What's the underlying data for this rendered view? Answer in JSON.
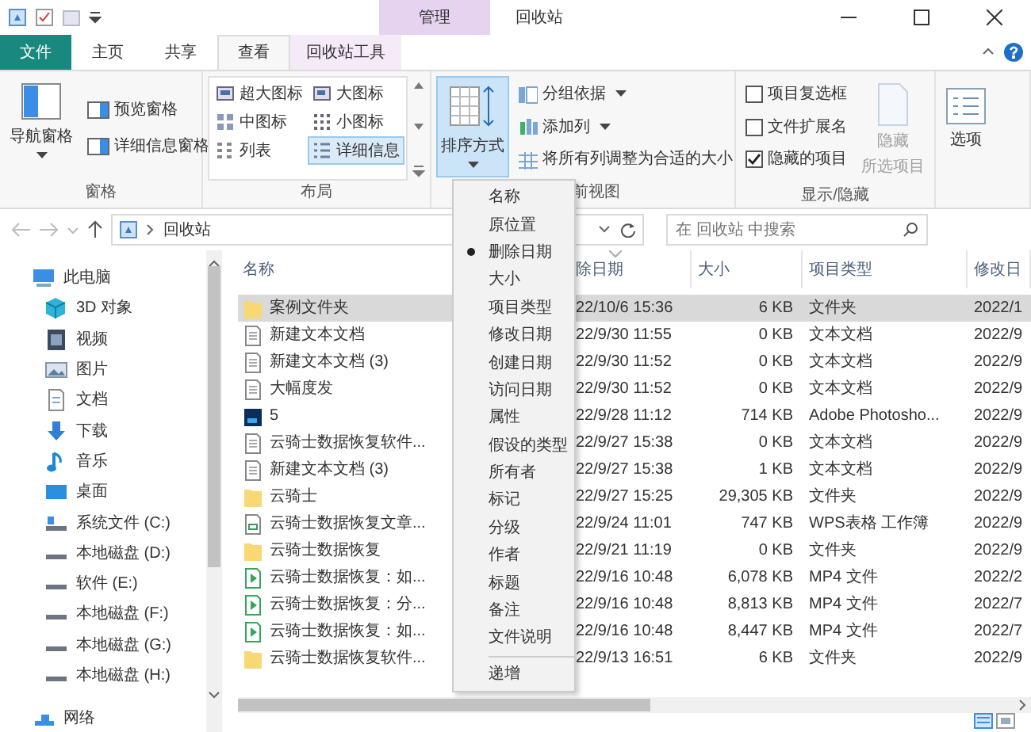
{
  "window": {
    "title": "回收站",
    "context_group": "管理"
  },
  "tabs": [
    {
      "label": "文件",
      "kind": "file",
      "selected": false
    },
    {
      "label": "主页",
      "kind": "plain",
      "selected": false
    },
    {
      "label": "共享",
      "kind": "plain",
      "selected": false
    },
    {
      "label": "查看",
      "kind": "plain",
      "selected": true
    },
    {
      "label": "回收站工具",
      "kind": "context",
      "selected": false
    }
  ],
  "ribbon": {
    "groups": [
      {
        "kind": "panes",
        "label": "窗格",
        "large": {
          "label": "导航窗格"
        },
        "items": [
          {
            "label": "预览窗格"
          },
          {
            "label": "详细信息窗格"
          }
        ]
      },
      {
        "kind": "layout",
        "label": "布局",
        "items": [
          {
            "label": "超大图标",
            "selected": false
          },
          {
            "label": "大图标",
            "selected": false
          },
          {
            "label": "中图标",
            "selected": false
          },
          {
            "label": "小图标",
            "selected": false
          },
          {
            "label": "列表",
            "selected": false
          },
          {
            "label": "详细信息",
            "selected": true
          }
        ]
      },
      {
        "kind": "view",
        "label": "前视图",
        "large": {
          "label": "排序方式",
          "selected": true
        },
        "items": [
          {
            "label": "分组依据",
            "dropdown": true
          },
          {
            "label": "添加列",
            "dropdown": true
          },
          {
            "label": "将所有列调整为合适的大小",
            "dropdown": false
          }
        ]
      },
      {
        "kind": "show",
        "label": "显示/隐藏",
        "checks": [
          {
            "label": "项目复选框",
            "checked": false
          },
          {
            "label": "文件扩展名",
            "checked": false
          },
          {
            "label": "隐藏的项目",
            "checked": true
          }
        ],
        "large": {
          "label": "隐藏",
          "label2": "所选项目",
          "disabled": true
        }
      },
      {
        "kind": "options",
        "large": {
          "label": "选项"
        }
      }
    ]
  },
  "address": {
    "location": "回收站"
  },
  "search": {
    "placeholder": "在 回收站 中搜索"
  },
  "nav": [
    {
      "label": "此电脑",
      "kind": "computer",
      "children": [
        {
          "label": "3D 对象",
          "kind": "cube"
        },
        {
          "label": "视频",
          "kind": "video"
        },
        {
          "label": "图片",
          "kind": "picture"
        },
        {
          "label": "文档",
          "kind": "document"
        },
        {
          "label": "下载",
          "kind": "download"
        },
        {
          "label": "音乐",
          "kind": "music"
        },
        {
          "label": "桌面",
          "kind": "desktop"
        },
        {
          "label": "系统文件 (C:)",
          "kind": "sysdrive"
        },
        {
          "label": "本地磁盘 (D:)",
          "kind": "drive"
        },
        {
          "label": "软件 (E:)",
          "kind": "drive"
        },
        {
          "label": "本地磁盘 (F:)",
          "kind": "drive"
        },
        {
          "label": "本地磁盘 (G:)",
          "kind": "drive"
        },
        {
          "label": "本地磁盘 (H:)",
          "kind": "drive"
        }
      ]
    },
    {
      "label": "网络",
      "kind": "network"
    }
  ],
  "table": {
    "columns": [
      "名称",
      "除日期",
      "大小",
      "项目类型",
      "修改日"
    ],
    "rows": [
      {
        "kind": "folder",
        "selected": true,
        "cells": [
          "案例文件夹",
          "22/10/6 15:36",
          "6 KB",
          "文件夹",
          "2022/1"
        ]
      },
      {
        "kind": "text",
        "selected": false,
        "cells": [
          "新建文本文档",
          "22/9/30 11:55",
          "0 KB",
          "文本文档",
          "2022/9"
        ]
      },
      {
        "kind": "text",
        "selected": false,
        "cells": [
          "新建文本文档 (3)",
          "22/9/30 11:52",
          "0 KB",
          "文本文档",
          "2022/9"
        ]
      },
      {
        "kind": "text",
        "selected": false,
        "cells": [
          "大幅度发",
          "22/9/30 11:52",
          "0 KB",
          "文本文档",
          "2022/9"
        ]
      },
      {
        "kind": "psd",
        "selected": false,
        "cells": [
          "5",
          "22/9/28 11:12",
          "714 KB",
          "Adobe Photosho...",
          "2022/9"
        ]
      },
      {
        "kind": "text",
        "selected": false,
        "cells": [
          "云骑士数据恢复软件...",
          "22/9/27 15:38",
          "0 KB",
          "文本文档",
          "2022/9"
        ]
      },
      {
        "kind": "text",
        "selected": false,
        "cells": [
          "新建文本文档 (3)",
          "22/9/27 15:38",
          "1 KB",
          "文本文档",
          "2022/9"
        ]
      },
      {
        "kind": "folder",
        "selected": false,
        "cells": [
          "云骑士",
          "22/9/27 15:25",
          "29,305 KB",
          "文件夹",
          "2022/9"
        ]
      },
      {
        "kind": "sheet",
        "selected": false,
        "cells": [
          "云骑士数据恢复文章...",
          "22/9/24 11:01",
          "747 KB",
          "WPS表格 工作簿",
          "2022/9"
        ]
      },
      {
        "kind": "folder",
        "selected": false,
        "cells": [
          "云骑士数据恢复",
          "22/9/21 11:19",
          "0 KB",
          "文件夹",
          "2022/9"
        ]
      },
      {
        "kind": "video",
        "selected": false,
        "cells": [
          "云骑士数据恢复：如...",
          "22/9/16 10:48",
          "6,078 KB",
          "MP4 文件",
          "2022/2"
        ]
      },
      {
        "kind": "video",
        "selected": false,
        "cells": [
          "云骑士数据恢复：分...",
          "22/9/16 10:48",
          "8,813 KB",
          "MP4 文件",
          "2022/7"
        ]
      },
      {
        "kind": "video",
        "selected": false,
        "cells": [
          "云骑士数据恢复：如...",
          "22/9/16 10:48",
          "8,447 KB",
          "MP4 文件",
          "2022/7"
        ]
      },
      {
        "kind": "folder",
        "selected": false,
        "cells": [
          "云骑士数据恢复软件...",
          "22/9/13 16:51",
          "6 KB",
          "文件夹",
          "2022/9"
        ]
      }
    ]
  },
  "sort_menu": {
    "items": [
      {
        "label": "名称",
        "selected": false
      },
      {
        "label": "原位置",
        "selected": false
      },
      {
        "label": "删除日期",
        "selected": true
      },
      {
        "label": "大小",
        "selected": false
      },
      {
        "label": "项目类型",
        "selected": false
      },
      {
        "label": "修改日期",
        "selected": false
      },
      {
        "label": "创建日期",
        "selected": false
      },
      {
        "label": "访问日期",
        "selected": false
      },
      {
        "label": "属性",
        "selected": false
      },
      {
        "label": "假设的类型",
        "selected": false
      },
      {
        "label": "所有者",
        "selected": false
      },
      {
        "label": "标记",
        "selected": false
      },
      {
        "label": "分级",
        "selected": false
      },
      {
        "label": "作者",
        "selected": false
      },
      {
        "label": "标题",
        "selected": false
      },
      {
        "label": "备注",
        "selected": false
      },
      {
        "label": "文件说明",
        "selected": false
      }
    ],
    "order": [
      {
        "label": "递增",
        "selected": false
      }
    ]
  }
}
